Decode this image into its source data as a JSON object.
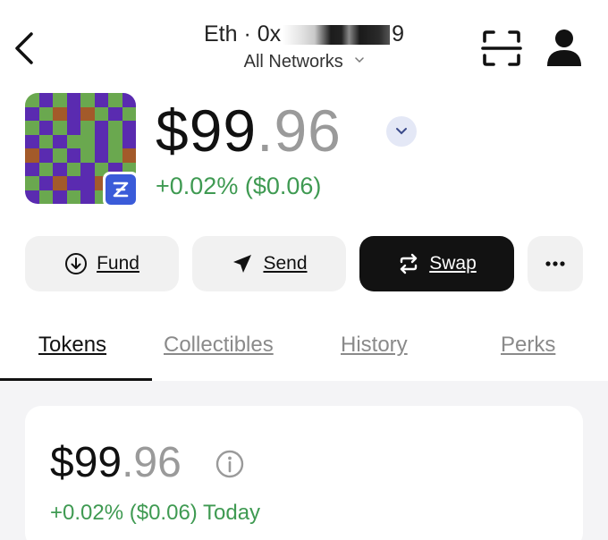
{
  "header": {
    "account_prefix": "Eth · 0x",
    "account_suffix": "9",
    "network_label": "All Networks"
  },
  "icons": {
    "back": "chevron-left-icon",
    "network_chevron": "chevron-down-icon",
    "scan": "scan-qr-icon",
    "profile": "person-icon",
    "balance_toggle": "chevron-down-icon",
    "fund": "arrow-down-circle-icon",
    "send": "paper-plane-icon",
    "swap": "swap-arrows-icon",
    "more": "ellipsis-icon",
    "info": "info-icon",
    "badge": "wallet-logo-icon"
  },
  "balance": {
    "whole": "$99",
    "fraction": ".96",
    "change": "+0.02% ($0.06)"
  },
  "actions": {
    "fund_label": "Fund",
    "send_label": "Send",
    "swap_label": "Swap"
  },
  "tabs": [
    {
      "label": "Tokens",
      "active": true
    },
    {
      "label": "Collectibles",
      "active": false
    },
    {
      "label": "History",
      "active": false
    },
    {
      "label": "Perks",
      "active": false
    }
  ],
  "summary": {
    "whole": "$99",
    "fraction": ".96",
    "change": "+0.02% ($0.06) Today"
  },
  "colors": {
    "positive_green": "#3f9a52",
    "avatar_purple": "#5a2bb0",
    "avatar_green": "#6aa84f",
    "avatar_brown": "#a35a2a",
    "badge_blue": "#3a5bd9",
    "swap_button": "#121212"
  }
}
